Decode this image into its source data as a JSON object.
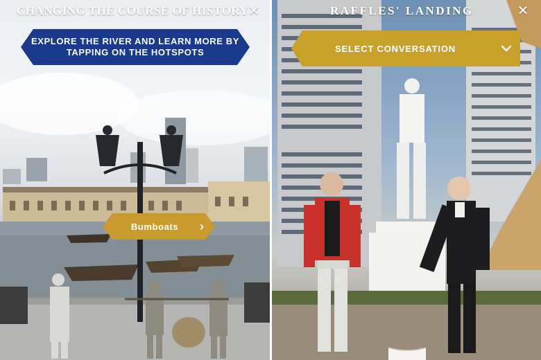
{
  "left_panel": {
    "title": "CHANGING THE COURSE OF HISTORY",
    "close_icon": "close-icon",
    "instruction": "EXPLORE THE RIVER AND LEARN MORE BY TAPPING ON THE HOTSPOTS",
    "hotspot": {
      "label": "Bumboats",
      "icon": "chevron-right-icon"
    }
  },
  "right_panel": {
    "title": "RAFFLES' LANDING",
    "close_icon": "close-icon",
    "conversation_select": {
      "label": "SELECT CONVERSATION",
      "icon": "chevron-down-icon"
    },
    "bottom_handle_icon": "tab-handle-icon"
  },
  "colors": {
    "navy_banner": "#1b3a8c",
    "gold_banner": "#c8a02a",
    "gold_hotspot": "#c99a2e",
    "white": "#ffffff"
  }
}
